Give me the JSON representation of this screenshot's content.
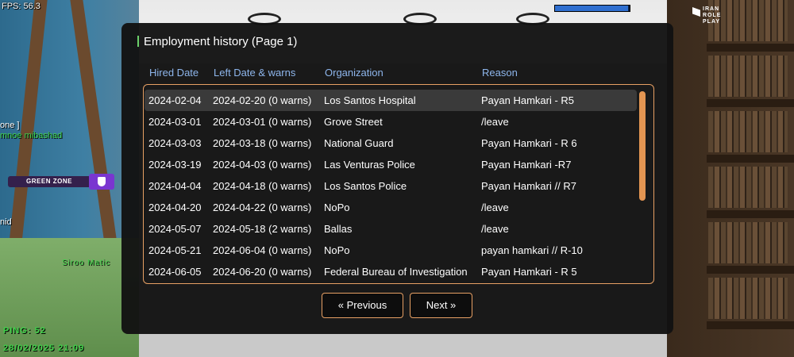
{
  "hud": {
    "fps": "FPS: 56.3",
    "ping": "PING: 52",
    "datetime": "28/02/2025 21:09",
    "logo_text": "IRAN ROLE PLAY",
    "green_zone_label": "GREEN ZONE",
    "top_bar_fill": 0.98,
    "chat_lines": [
      "one ]",
      "mnoe mibashad",
      "nid",
      "Siroo Matic"
    ]
  },
  "dialog": {
    "title": "Employment history (Page 1)",
    "columns": [
      "Hired Date",
      "Left Date & warns",
      "Organization",
      "Reason"
    ],
    "rows": [
      {
        "hired": "2024-02-04",
        "left": "2024-02-20 (0 warns)",
        "org": "Los Santos Hospital",
        "reason": "Payan Hamkari - R5"
      },
      {
        "hired": "2024-03-01",
        "left": "2024-03-01 (0 warns)",
        "org": "Grove Street",
        "reason": "/leave"
      },
      {
        "hired": "2024-03-03",
        "left": "2024-03-18 (0 warns)",
        "org": "National Guard",
        "reason": "Payan Hamkari - R 6"
      },
      {
        "hired": "2024-03-19",
        "left": "2024-04-03 (0 warns)",
        "org": "Las Venturas Police",
        "reason": "Payan Hamkari -R7"
      },
      {
        "hired": "2024-04-04",
        "left": "2024-04-18 (0 warns)",
        "org": "Los Santos Police",
        "reason": "Payan Hamkari // R7"
      },
      {
        "hired": "2024-04-20",
        "left": "2024-04-22 (0 warns)",
        "org": "NoPo",
        "reason": "/leave"
      },
      {
        "hired": "2024-05-07",
        "left": "2024-05-18 (2 warns)",
        "org": "Ballas",
        "reason": "/leave"
      },
      {
        "hired": "2024-05-21",
        "left": "2024-06-04 (0 warns)",
        "org": "NoPo",
        "reason": "payan hamkari // R-10"
      },
      {
        "hired": "2024-06-05",
        "left": "2024-06-20 (0 warns)",
        "org": "Federal Bureau of Investigation",
        "reason": "Payan Hamkari - R 5"
      }
    ],
    "selected_row": 0,
    "buttons": {
      "previous": "« Previous",
      "next": "Next »"
    }
  },
  "colors": {
    "accent_orange": "#e7a064",
    "header_blue": "#8eb6ec",
    "hud_green": "#3fd24a",
    "zone_purple": "#7a36d0"
  }
}
